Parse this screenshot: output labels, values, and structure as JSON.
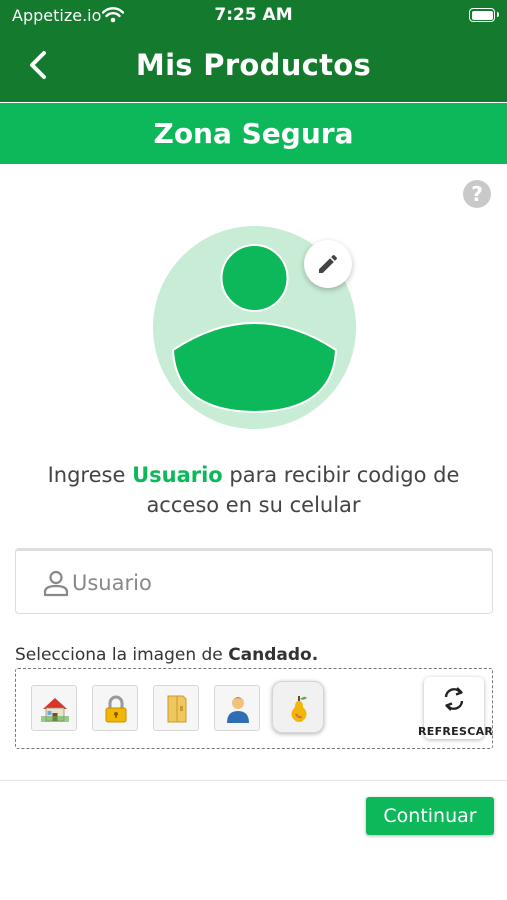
{
  "status_bar": {
    "carrier": "Appetize.io",
    "time": "7:25 AM"
  },
  "nav": {
    "title": "Mis Productos",
    "back_icon": "chevron-left-icon"
  },
  "zone": {
    "title": "Zona Segura"
  },
  "help": {
    "symbol": "?"
  },
  "instruction": {
    "prefix": "Ingrese ",
    "highlight": "Usuario",
    "suffix": " para recibir codigo de acceso en su celular"
  },
  "user_field": {
    "placeholder": "Usuario",
    "value": ""
  },
  "image_select": {
    "prefix": "Selecciona la imagen de ",
    "highlight": "Candado.",
    "options": [
      "house-icon",
      "padlock-icon",
      "folder-icon",
      "person-icon",
      "pear-icon"
    ],
    "selected_index": 4
  },
  "refresh": {
    "label": "REFRESCAR"
  },
  "continue": {
    "label": "Continuar"
  },
  "colors": {
    "nav_green": "#147a2e",
    "accent_green": "#0db85a",
    "avatar_bg": "#c8ecd5"
  }
}
